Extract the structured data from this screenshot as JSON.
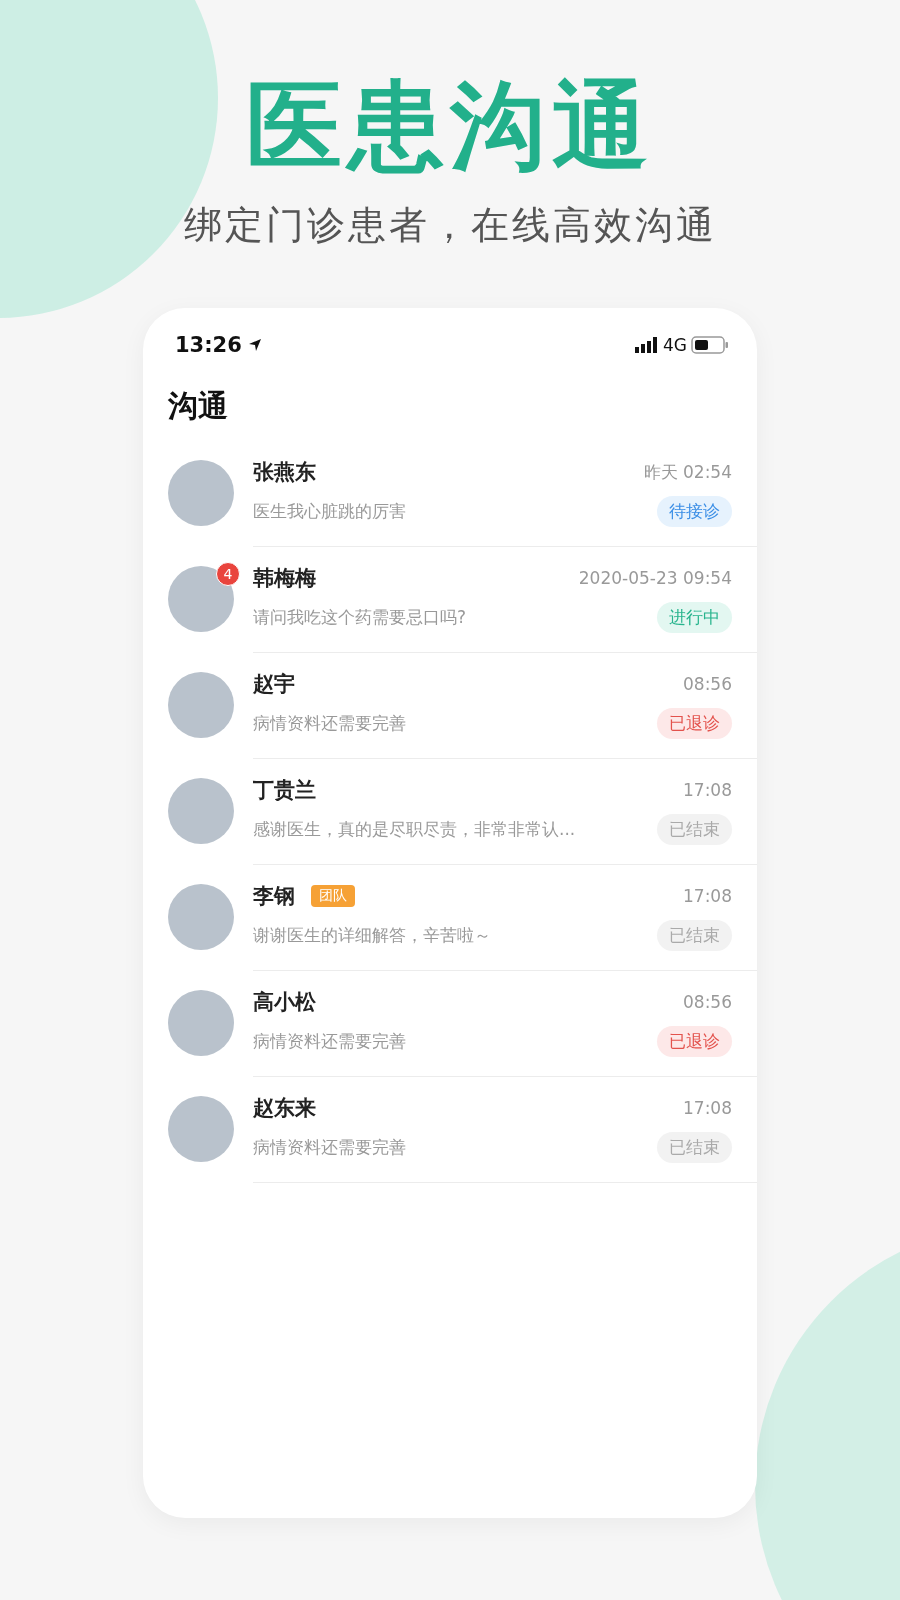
{
  "promo": {
    "title": "医患沟通",
    "subtitle": "绑定门诊患者，在线高效沟通"
  },
  "status_bar": {
    "time": "13:26",
    "network": "4G"
  },
  "page_title": "沟通",
  "conversations": [
    {
      "name": "张燕东",
      "time": "昨天 02:54",
      "message": "医生我心脏跳的厉害",
      "status": {
        "label": "待接诊",
        "kind": "waiting"
      }
    },
    {
      "name": "韩梅梅",
      "unread": "4",
      "time": "2020-05-23 09:54",
      "message": "请问我吃这个药需要忌口吗?",
      "status": {
        "label": "进行中",
        "kind": "active"
      }
    },
    {
      "name": "赵宇",
      "time": "08:56",
      "message": "病情资料还需要完善",
      "status": {
        "label": "已退诊",
        "kind": "withdrawn"
      }
    },
    {
      "name": "丁贵兰",
      "time": "17:08",
      "message": "感谢医生，真的是尽职尽责，非常非常认...",
      "status": {
        "label": "已结束",
        "kind": "ended"
      }
    },
    {
      "name": "李钢",
      "tag": "团队",
      "time": "17:08",
      "message": "谢谢医生的详细解答，辛苦啦～",
      "status": {
        "label": "已结束",
        "kind": "ended"
      }
    },
    {
      "name": "高小松",
      "time": "08:56",
      "message": "病情资料还需要完善",
      "status": {
        "label": "已退诊",
        "kind": "withdrawn"
      }
    },
    {
      "name": "赵东来",
      "time": "17:08",
      "message": "病情资料还需要完善",
      "status": {
        "label": "已结束",
        "kind": "ended"
      }
    }
  ]
}
